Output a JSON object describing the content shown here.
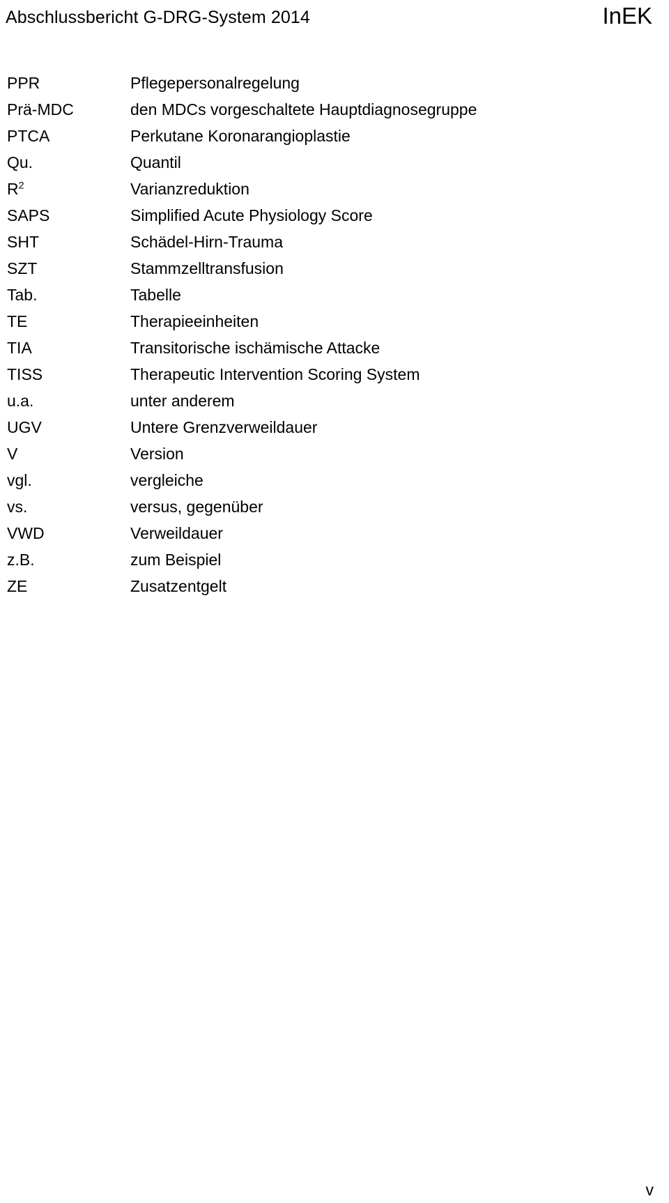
{
  "header": {
    "document_title": "Abschlussbericht G-DRG-System 2014",
    "brand": "InEK"
  },
  "abbreviations": [
    {
      "term": "PPR",
      "term_sup": "",
      "definition": "Pflegepersonalregelung"
    },
    {
      "term": "Prä-MDC",
      "term_sup": "",
      "definition": "den MDCs vorgeschaltete Hauptdiagnosegruppe"
    },
    {
      "term": "PTCA",
      "term_sup": "",
      "definition": "Perkutane Koronarangioplastie"
    },
    {
      "term": "Qu.",
      "term_sup": "",
      "definition": "Quantil"
    },
    {
      "term": "R",
      "term_sup": "2",
      "definition": "Varianzreduktion"
    },
    {
      "term": "SAPS",
      "term_sup": "",
      "definition": "Simplified Acute Physiology Score"
    },
    {
      "term": "SHT",
      "term_sup": "",
      "definition": "Schädel-Hirn-Trauma"
    },
    {
      "term": "SZT",
      "term_sup": "",
      "definition": "Stammzelltransfusion"
    },
    {
      "term": "Tab.",
      "term_sup": "",
      "definition": "Tabelle"
    },
    {
      "term": "TE",
      "term_sup": "",
      "definition": "Therapieeinheiten"
    },
    {
      "term": "TIA",
      "term_sup": "",
      "definition": "Transitorische ischämische Attacke"
    },
    {
      "term": "TISS",
      "term_sup": "",
      "definition": "Therapeutic Intervention Scoring System"
    },
    {
      "term": "u.a.",
      "term_sup": "",
      "definition": "unter anderem"
    },
    {
      "term": "UGV",
      "term_sup": "",
      "definition": "Untere Grenzverweildauer"
    },
    {
      "term": "V",
      "term_sup": "",
      "definition": "Version"
    },
    {
      "term": "vgl.",
      "term_sup": "",
      "definition": "vergleiche"
    },
    {
      "term": "vs.",
      "term_sup": "",
      "definition": "versus, gegenüber"
    },
    {
      "term": "VWD",
      "term_sup": "",
      "definition": "Verweildauer"
    },
    {
      "term": "z.B.",
      "term_sup": "",
      "definition": "zum Beispiel"
    },
    {
      "term": "ZE",
      "term_sup": "",
      "definition": "Zusatzentgelt"
    }
  ],
  "footer": {
    "page_number": "v"
  }
}
